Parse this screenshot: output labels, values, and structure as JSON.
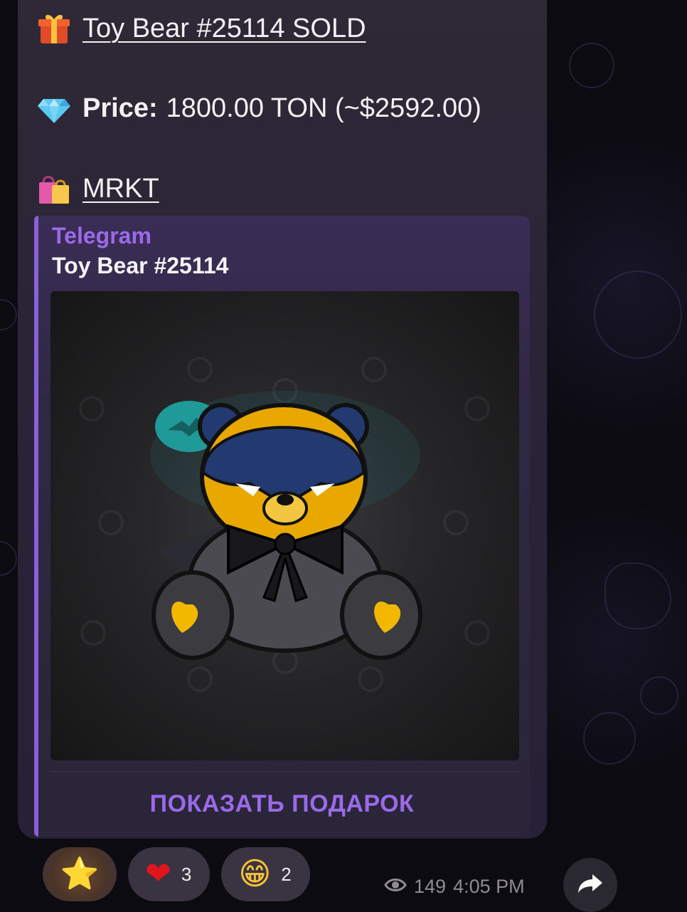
{
  "message": {
    "line1": {
      "icon": "gift-emoji",
      "emoji": "🎁",
      "text": "Toy Bear #25114 SOLD"
    },
    "line2": {
      "icon": "gem-emoji",
      "emoji": "💎",
      "label": "Price:",
      "value": "1800.00 TON (~$2592.00)"
    },
    "line3": {
      "icon": "shopping-bags-emoji",
      "emoji": "🛍",
      "text": "MRKT"
    }
  },
  "preview": {
    "site": "Telegram",
    "title": "Toy Bear #25114",
    "image": "toy-bear-batman-gift",
    "button_label": "ПОКАЗАТЬ ПОДАРОК",
    "accent": "#8b5fd8"
  },
  "reactions": [
    {
      "emoji": "⭐",
      "name": "star-reaction",
      "count": ""
    },
    {
      "emoji": "❤",
      "name": "heart-reaction",
      "count": "3"
    },
    {
      "emoji": "😁",
      "name": "grin-reaction",
      "count": "2"
    }
  ],
  "meta": {
    "views": "149",
    "time": "4:05 PM"
  },
  "share_icon": "share-arrow-icon"
}
